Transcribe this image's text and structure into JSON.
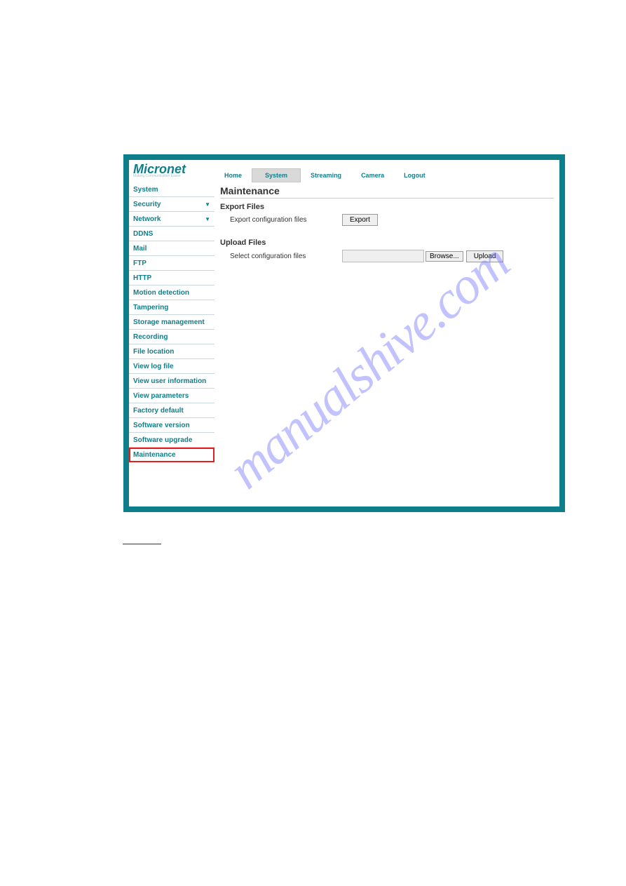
{
  "logo": {
    "main": "Micronet",
    "sub": "Making Communication Easier"
  },
  "topnav": {
    "items": [
      "Home",
      "System",
      "Streaming",
      "Camera",
      "Logout"
    ],
    "selected_index": 1
  },
  "sidebar": {
    "items": [
      {
        "label": "System",
        "dropdown": false
      },
      {
        "label": "Security",
        "dropdown": true
      },
      {
        "label": "Network",
        "dropdown": true
      },
      {
        "label": "DDNS",
        "dropdown": false
      },
      {
        "label": "Mail",
        "dropdown": false
      },
      {
        "label": "FTP",
        "dropdown": false
      },
      {
        "label": "HTTP",
        "dropdown": false
      },
      {
        "label": "Motion detection",
        "dropdown": false
      },
      {
        "label": "Tampering",
        "dropdown": false
      },
      {
        "label": "Storage management",
        "dropdown": false
      },
      {
        "label": "Recording",
        "dropdown": false
      },
      {
        "label": "File location",
        "dropdown": false
      },
      {
        "label": "View log file",
        "dropdown": false
      },
      {
        "label": "View user information",
        "dropdown": false
      },
      {
        "label": "View parameters",
        "dropdown": false
      },
      {
        "label": "Factory default",
        "dropdown": false
      },
      {
        "label": "Software version",
        "dropdown": false
      },
      {
        "label": "Software upgrade",
        "dropdown": false
      },
      {
        "label": "Maintenance",
        "dropdown": false,
        "highlighted": true
      }
    ]
  },
  "content": {
    "page_title": "Maintenance",
    "export_section": {
      "title": "Export Files",
      "label": "Export configuration files",
      "button": "Export"
    },
    "upload_section": {
      "title": "Upload Files",
      "label": "Select configuration files",
      "browse": "Browse...",
      "upload": "Upload"
    }
  },
  "watermark": "manualshive.com"
}
